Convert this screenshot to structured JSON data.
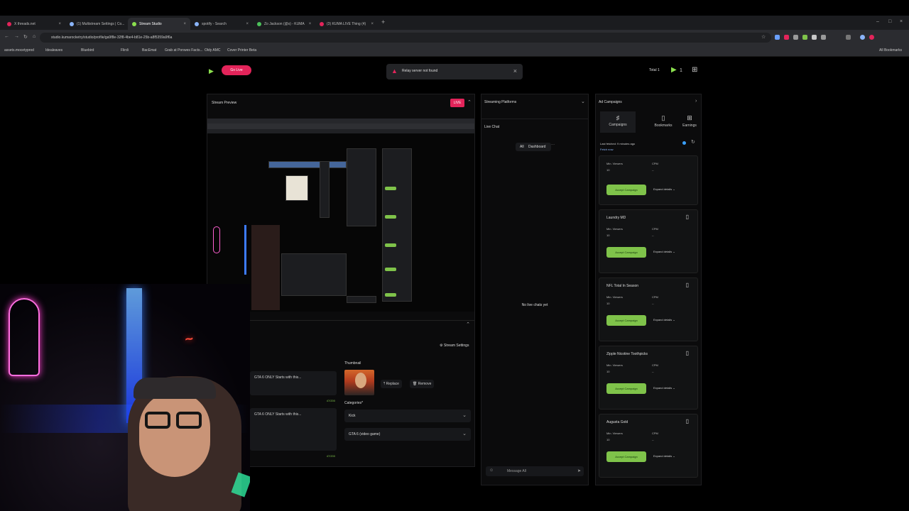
{
  "browser": {
    "tabs": [
      {
        "label": "X threads.net",
        "color": "#e3245a"
      },
      {
        "label": "(1) Multistream Settings | Co...",
        "color": "#8ab4f8"
      },
      {
        "label": "Stream Studio",
        "color": "#8be04e"
      },
      {
        "label": "spotify - Search",
        "color": "#8ab4f8"
      },
      {
        "label": "Zo Jackson (@s) - KUMA",
        "color": "#4cc15a"
      },
      {
        "label": "(3) KUMA LIVE Thing (4)",
        "color": "#e3245a"
      }
    ],
    "url": "studio.kumarocketry/studio/profile/ga9f8e-32f8-4be4-b81e-25b-a8f5359a9f6a",
    "bookmarks": [
      "assets.mocetyprod",
      "Idealeaves",
      "Bluebird",
      "Flirdi",
      "BacEmat",
      "Grab at Ponwes Facts...",
      "Oldy AMC",
      "Cover Printer Beta"
    ],
    "all_bookmarks": "All Bookmarks"
  },
  "app": {
    "go_live_label": "Go Live",
    "toast": "Relay server not found",
    "total_label": "Total",
    "total_count": "1",
    "accent": "#e3245a",
    "green": "#7fc34a"
  },
  "preview": {
    "title": "Stream Preview",
    "live_badge": "LIVE"
  },
  "settings": {
    "stream_settings_label": "Stream Settings",
    "title_1": "GTA 6 ONLY Starts with this...",
    "title_2": "GTA 6 ONLY Starts with this...",
    "char_count_1": "47/200",
    "char_count_2": "47/200",
    "thumbnail_label": "Thumbnail",
    "replace_label": "Replace",
    "remove_label": "Remove",
    "categories_label": "Categories*",
    "category_1": "Kick",
    "category_2": "GTA 6 (video game)"
  },
  "platforms": {
    "title": "Streaming Platforms",
    "live_chat_label": "Live Chat",
    "filter_label": "All",
    "filter_value": "Dashboard",
    "no_chats": "No live chats yet",
    "message_placeholder": "Message All"
  },
  "ads": {
    "title": "Ad Campaigns",
    "tabs": [
      "Campaigns",
      "Bookmarks",
      "Earnings"
    ],
    "last_fetched": "Last fetched: 9 minutes ago",
    "fetch_now": "Fetch now",
    "metric_1_label": "Min. Viewers",
    "metric_2_label": "CPM",
    "metric_2_value": "--",
    "accept_label": "Accept Campaign",
    "expand_label": "Expand details",
    "campaigns": [
      {
        "name": "",
        "viewers": "10"
      },
      {
        "name": "Laundry MD",
        "viewers": "10"
      },
      {
        "name": "NFL Total In Season",
        "viewers": "10"
      },
      {
        "name": "Zipple Nicotine Toothpicks",
        "viewers": "10"
      },
      {
        "name": "Augusta Gold",
        "viewers": "10"
      }
    ]
  }
}
